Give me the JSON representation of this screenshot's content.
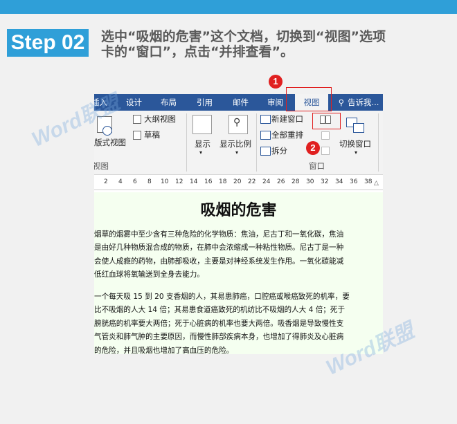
{
  "header": {
    "step_label": "Step 02",
    "instruction_line1": "选中“吸烟的危害”这个文档，切换到“视图”选项",
    "instruction_line2": "卡的“窗口”，点击“并排查看”。"
  },
  "ribbon_tabs": [
    "插入",
    "设计",
    "布局",
    "引用",
    "邮件",
    "审阅",
    "视图",
    "告诉我..."
  ],
  "ribbon": {
    "web_layout": "版式视图",
    "outline": "大纲视图",
    "draft": "草稿",
    "views_group": "视图",
    "show": "显示",
    "zoom": "显示比例",
    "new_window": "新建窗口",
    "arrange_all": "全部重排",
    "split": "拆分",
    "switch_window": "切换窗口",
    "window_group": "窗口"
  },
  "ruler_ticks": [
    "2",
    "4",
    "6",
    "8",
    "10",
    "12",
    "14",
    "16",
    "18",
    "20",
    "22",
    "24",
    "26",
    "28",
    "30",
    "32",
    "34",
    "36",
    "38"
  ],
  "document": {
    "title": "吸烟的危害",
    "p1": [
      "烟草的烟雾中至少含有三种危险的化学物质：焦油，尼古丁和一氧化碳，焦油",
      "是由好几种物质混合成的物质，在肺中会浓缩成一种粘性物质。尼古丁是一种",
      "会使人成瘾的药物，由肺部吸收，主要是对神经系统发生作用。一氧化碳能减",
      "低红血球将氧输送到全身去能力。"
    ],
    "p2": [
      "一个每天吸 15 到 20 支香烟的人，其易患肺癌，口腔癌或喉癌致死的机率，要",
      "比不吸烟的人大 14 倍；其易患食道癌致死的机纺比不吸烟的人大 4 倍；死于",
      "膀胱癌的机率要大两倍；死于心脏病的机率也要大两倍。吸香烟是导致慢性支",
      "气管炎和肺气肿的主要原因，而慢性肺部疾病本身，也增加了得肺炎及心脏病",
      "的危险，并且吸烟也增加了高血压的危险。"
    ]
  },
  "markers": [
    "1",
    "2"
  ],
  "watermark": "Word联盟",
  "colors": {
    "accent": "#2f9fd8",
    "tab_bar": "#2b579a",
    "highlight": "#e02020",
    "doc_bg": "#f5fff0"
  }
}
